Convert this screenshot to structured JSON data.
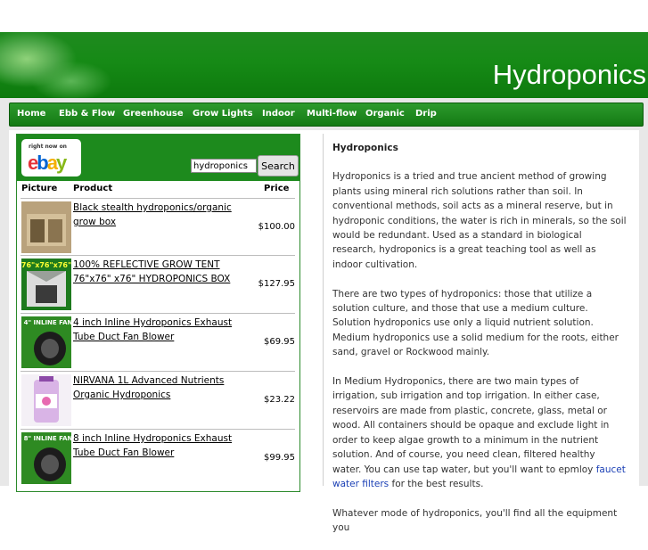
{
  "site": {
    "title": "Hydroponics"
  },
  "nav": {
    "items": [
      {
        "label": "Home"
      },
      {
        "label": "Ebb & Flow"
      },
      {
        "label": "Greenhouse"
      },
      {
        "label": "Grow Lights"
      },
      {
        "label": "Indoor"
      },
      {
        "label": "Multi-flow"
      },
      {
        "label": "Organic"
      },
      {
        "label": "Drip"
      }
    ]
  },
  "widget": {
    "ebay_small": "right now on",
    "ebay_logo": [
      "e",
      "b",
      "a",
      "y"
    ],
    "search_value": "hydroponics",
    "search_button": "Search",
    "headers": {
      "picture": "Picture",
      "product": "Product",
      "price": "Price"
    },
    "products": [
      {
        "title": "Black stealth hydroponics/organic grow box",
        "price": "$100.00",
        "thumb": "tan-grow-box"
      },
      {
        "title": "100% REFLECTIVE GROW TENT 76\"x76\" x76\" HYDROPONICS BOX",
        "price": "$127.95",
        "thumb": "grow-tent",
        "thumb_label": "76\"x76\"x76\""
      },
      {
        "title": "4 inch Inline Hydroponics Exhaust Tube Duct Fan Blower",
        "price": "$69.95",
        "thumb": "inline-fan",
        "thumb_label": "4\" INLINE FAN"
      },
      {
        "title": "NIRVANA 1L Advanced Nutrients Organic Hydroponics",
        "price": "$23.22",
        "thumb": "nutrient-bottle"
      },
      {
        "title": "8 inch Inline Hydroponics Exhaust Tube Duct Fan Blower",
        "price": "$99.95",
        "thumb": "inline-fan",
        "thumb_label": "8\" INLINE FAN"
      }
    ]
  },
  "article": {
    "heading": "Hydroponics",
    "p1": "Hydroponics is a tried and true ancient method of growing plants using mineral rich solutions rather than soil. In conventional methods, soil acts as a mineral reserve, but in hydroponic conditions, the water is rich in minerals, so the soil would be redundant. Used as a standard in biological research, hydroponics is a great teaching tool as well as indoor cultivation.",
    "p2": "There are two types of hydroponics: those that utilize a solution culture, and those that use a medium culture. Solution hydroponics use only a liquid nutrient solution. Medium hydroponics use a solid medium for the roots, either sand, gravel or Rockwood mainly.",
    "p3_before": "In Medium Hydroponics, there are two main types of irrigation, sub irrigation and top irrigation. In either case, reservoirs are made from plastic, concrete, glass, metal or wood. All containers should be opaque and exclude light in order to keep algae growth to a minimum in the nutrient solution. And of course, you need clean, filtered healthy water. You can use tap water, but you'll want to epmloy ",
    "p3_link": "faucet water filters",
    "p3_after": " for the best results.",
    "p4": "Whatever mode of hydroponics, you'll find all the equipment you"
  },
  "colors": {
    "green": "#1d8a1d",
    "nav_green": "#137a13",
    "link_blue": "#1a3fb5"
  }
}
